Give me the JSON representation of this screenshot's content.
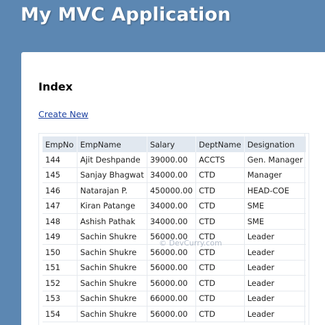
{
  "app": {
    "title": "My MVC Application"
  },
  "page": {
    "title": "Index",
    "create_link": "Create New"
  },
  "watermark": "© DevCurry.com",
  "table": {
    "columns": [
      "EmpNo",
      "EmpName",
      "Salary",
      "DeptName",
      "Designation"
    ],
    "rows": [
      [
        "144",
        "Ajit Deshpande",
        "39000.00",
        "ACCTS",
        "Gen. Manager"
      ],
      [
        "145",
        "Sanjay Bhagwat",
        "34000.00",
        "CTD",
        "Manager"
      ],
      [
        "146",
        "Natarajan P.",
        "450000.00",
        "CTD",
        "HEAD-COE"
      ],
      [
        "147",
        "Kiran Patange",
        "34000.00",
        "CTD",
        "SME"
      ],
      [
        "148",
        "Ashish Pathak",
        "34000.00",
        "CTD",
        "SME"
      ],
      [
        "149",
        "Sachin Shukre",
        "56000.00",
        "CTD",
        "Leader"
      ],
      [
        "150",
        "Sachin Shukre",
        "56000.00",
        "CTD",
        "Leader"
      ],
      [
        "151",
        "Sachin Shukre",
        "56000.00",
        "CTD",
        "Leader"
      ],
      [
        "152",
        "Sachin Shukre",
        "56000.00",
        "CTD",
        "Leader"
      ],
      [
        "153",
        "Sachin Shukre",
        "66000.00",
        "CTD",
        "Leader"
      ],
      [
        "154",
        "Sachin Shukre",
        "56000.00",
        "CTD",
        "Leader"
      ]
    ]
  }
}
